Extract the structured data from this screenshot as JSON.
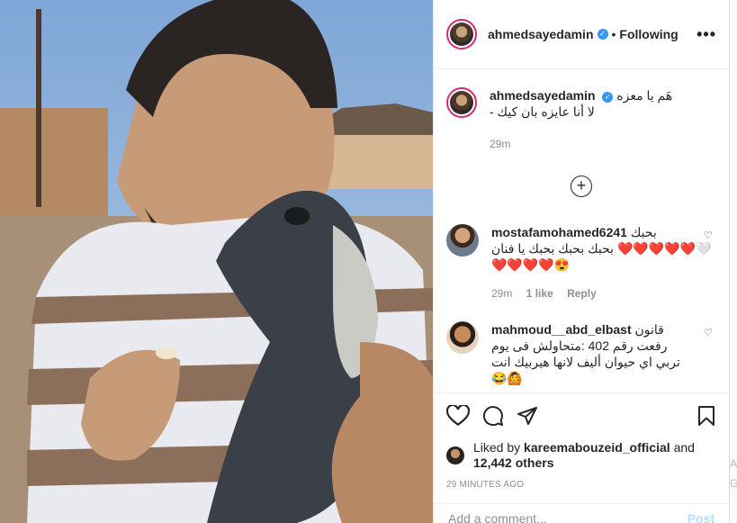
{
  "post": {
    "username": "ahmedsayedamin",
    "follow_status": "Following",
    "caption_line1": "هَم يا معزه",
    "caption_line2": "لا أنا عايزه بان كيك -",
    "caption_time": "29m",
    "likes_text_prefix": "Liked by",
    "liked_by": "kareemabouzeid_official",
    "likes_and": "and",
    "likes_others": "12,442 others",
    "time_ago": "29 MINUTES AGO",
    "add_comment_placeholder": "Add a comment...",
    "post_label": "Post"
  },
  "comments": [
    {
      "username": "mostafamohamed6241",
      "text_line1": "بحبك",
      "text_line2": "بحبك بحبك بحبك يا فنان ❤️❤️❤️❤️❤️🤍",
      "text_line3": "❤️❤️❤️❤️😍",
      "time": "29m",
      "likes": "1 like",
      "reply": "Reply"
    },
    {
      "username": "mahmoud__abd_elbast",
      "text_line1": "قانون",
      "text_line2": "رفعت رقم 402 :متحاولش فى يوم",
      "text_line3": "تربي اي حيوان أليف لانها هيربيك انت",
      "text_line4": "😂🙆"
    }
  ],
  "icons": [
    "more-options-icon",
    "verified-badge-icon",
    "load-more-icon",
    "heart-icon",
    "comment-icon",
    "share-icon",
    "save-icon"
  ],
  "edge_glyphs": [
    "A",
    "G"
  ],
  "colors": {
    "accent": "#3897f0",
    "story_ring": "#d62976",
    "muted": "#8e8e8e",
    "post_disabled": "#b2dffc"
  }
}
